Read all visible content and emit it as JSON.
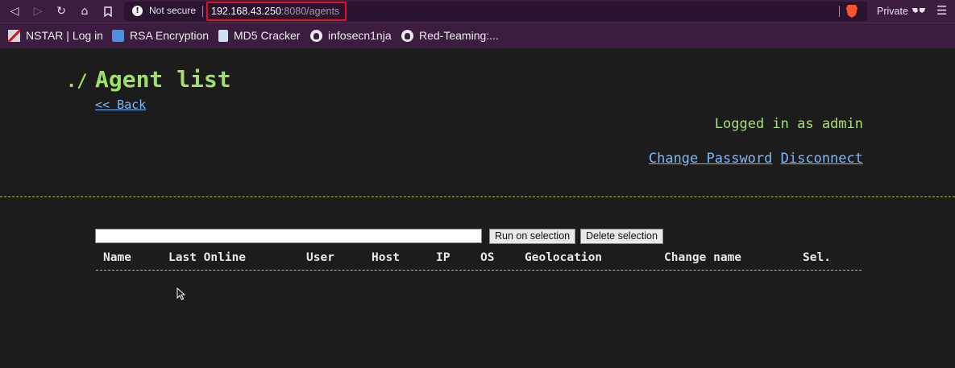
{
  "browser": {
    "security_text": "Not secure",
    "url_host": "192.168.43.250",
    "url_rest": ":8080/agents",
    "private_label": "Private",
    "bookmarks": [
      {
        "label": "NSTAR | Log in",
        "icon": "nstar-icon"
      },
      {
        "label": "RSA Encryption",
        "icon": "rsa-icon"
      },
      {
        "label": "MD5 Cracker",
        "icon": "document-icon"
      },
      {
        "label": "infosecn1nja",
        "icon": "github-icon"
      },
      {
        "label": "Red-Teaming:...",
        "icon": "github-icon"
      }
    ],
    "accent_highlight": "#e0141a"
  },
  "page": {
    "title_prefix": "./",
    "title": "Agent list",
    "back_link": "<< Back",
    "logged_in": "Logged in as admin",
    "change_password": "Change Password",
    "disconnect": "Disconnect",
    "input_value": "",
    "run_button": "Run on selection",
    "delete_button": "Delete selection",
    "columns": [
      "Name",
      "Last Online",
      "User",
      "Host",
      "IP",
      "OS",
      "Geolocation",
      "Change name",
      "Sel."
    ],
    "rows": []
  },
  "colors": {
    "background": "#1c1c1c",
    "title": "#9fe06a",
    "link": "#7ab8ff",
    "chrome": "#3b1d3f"
  }
}
